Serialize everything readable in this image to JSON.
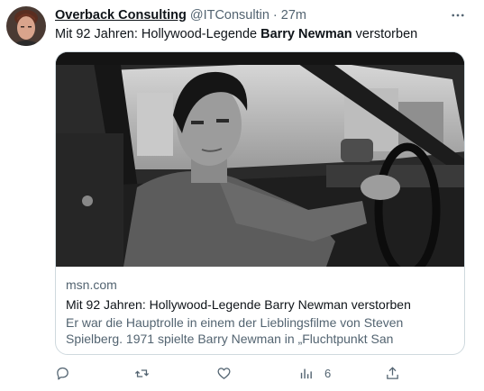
{
  "tweet": {
    "display_name": "Overback Consulting",
    "handle": "@ITConsultin",
    "separator": "·",
    "time": "27m",
    "more_icon": "more-horizontal-icon",
    "text_before": "Mit 92 Jahren: Hollywood-Legende ",
    "text_bold": "Barry Newman",
    "text_after": " verstorben"
  },
  "card": {
    "domain": "msn.com",
    "title": "Mit 92 Jahren: Hollywood-Legende Barry Newman verstorben",
    "description": "Er war die Hauptrolle in einem der Lieblingsfilme von Steven Spielberg. 1971 spielte Barry Newman in „Fluchtpunkt San Francisco…"
  },
  "actions": {
    "reply_icon": "reply-icon",
    "retweet_icon": "retweet-icon",
    "like_icon": "like-icon",
    "views_icon": "views-icon",
    "views_count": "6",
    "share_icon": "share-icon"
  },
  "colors": {
    "text_primary": "#0f1419",
    "text_secondary": "#536471",
    "border": "#cfd9de"
  }
}
